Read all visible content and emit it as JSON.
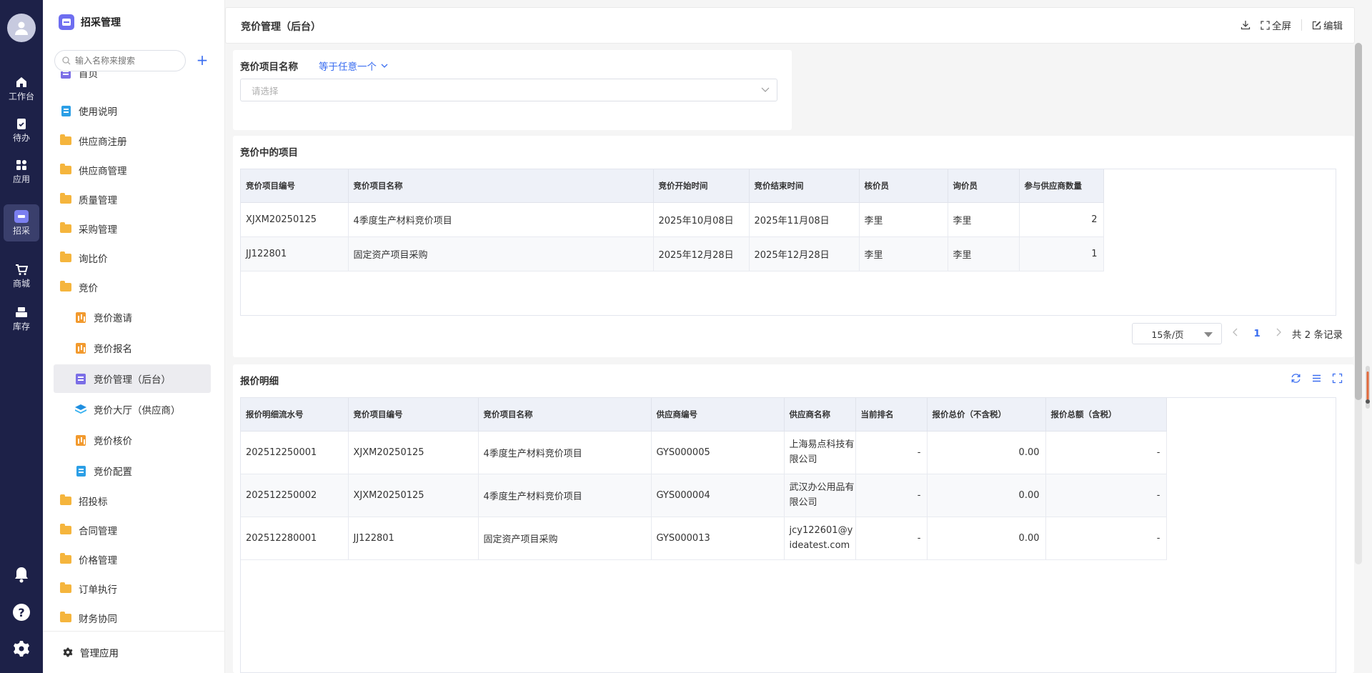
{
  "nav": {
    "items": [
      {
        "label": "工作台",
        "icon": "home-icon"
      },
      {
        "label": "待办",
        "icon": "clipboard-icon"
      },
      {
        "label": "应用",
        "icon": "apps-grid-icon"
      },
      {
        "label": "招采",
        "icon": "procurement-icon"
      },
      {
        "label": "商城",
        "icon": "cart-icon"
      },
      {
        "label": "库存",
        "icon": "inventory-icon"
      }
    ],
    "active_index": 3
  },
  "sidebar": {
    "title": "招采管理",
    "search_placeholder": "输入名称来搜索",
    "add_label": "+",
    "items": [
      {
        "label": "首页",
        "type": "docp",
        "level": 1
      },
      {
        "label": "使用说明",
        "type": "doc",
        "level": 1
      },
      {
        "label": "供应商注册",
        "type": "folder",
        "level": 1
      },
      {
        "label": "供应商管理",
        "type": "folder",
        "level": 1
      },
      {
        "label": "质量管理",
        "type": "folder",
        "level": 1
      },
      {
        "label": "采购管理",
        "type": "folder",
        "level": 1
      },
      {
        "label": "询比价",
        "type": "folder",
        "level": 1
      },
      {
        "label": "竞价",
        "type": "folder",
        "level": 1
      },
      {
        "label": "竞价邀请",
        "type": "chart",
        "level": 2
      },
      {
        "label": "竞价报名",
        "type": "chart",
        "level": 2
      },
      {
        "label": "竞价管理（后台）",
        "type": "docp",
        "level": 2,
        "active": true
      },
      {
        "label": "竞价大厅（供应商）",
        "type": "layers",
        "level": 2
      },
      {
        "label": "竞价核价",
        "type": "chart",
        "level": 2
      },
      {
        "label": "竞价配置",
        "type": "doc",
        "level": 2
      },
      {
        "label": "招投标",
        "type": "folder",
        "level": 1
      },
      {
        "label": "合同管理",
        "type": "folder",
        "level": 1
      },
      {
        "label": "价格管理",
        "type": "folder",
        "level": 1
      },
      {
        "label": "订单执行",
        "type": "folder",
        "level": 1
      },
      {
        "label": "财务协同",
        "type": "folder",
        "level": 1
      }
    ],
    "footer_label": "管理应用"
  },
  "header": {
    "title": "竞价管理（后台）",
    "fullscreen_label": "全屏",
    "edit_label": "编辑"
  },
  "filter": {
    "label": "竞价项目名称",
    "operator": "等于任意一个",
    "placeholder": "请选择"
  },
  "bidding": {
    "title": "竞价中的项目",
    "columns": [
      "竞价项目编号",
      "竞价项目名称",
      "竞价开始时间",
      "竞价结束时间",
      "核价员",
      "询价员",
      "参与供应商数量"
    ],
    "rows": [
      [
        "XJXM20250125",
        "4季度生产材料竞价项目",
        "2025年10月08日",
        "2025年11月08日",
        "李里",
        "李里",
        "2"
      ],
      [
        "JJ122801",
        "固定资产项目采购",
        "2025年12月28日",
        "2025年12月28日",
        "李里",
        "李里",
        "1"
      ]
    ],
    "pager": {
      "page_size": "15条/页",
      "current_page": "1",
      "total_text": "共 2 条记录"
    }
  },
  "quotes": {
    "title": "报价明细",
    "columns": [
      "报价明细流水号",
      "竞价项目编号",
      "竞价项目名称",
      "供应商编号",
      "供应商名称",
      "当前排名",
      "报价总价（不含税）",
      "报价总额（含税）"
    ],
    "rows": [
      [
        "202512250001",
        "XJXM20250125",
        "4季度生产材料竞价项目",
        "GYS000005",
        "上海易点科技有限公司",
        "-",
        "0.00",
        "-"
      ],
      [
        "202512250002",
        "XJXM20250125",
        "4季度生产材料竞价项目",
        "GYS000004",
        "武汉办公用品有限公司",
        "-",
        "0.00",
        "-"
      ],
      [
        "202512280001",
        "JJ122801",
        "固定资产项目采购",
        "GYS000013",
        "jcy122601@yideatest.com",
        "-",
        "0.00",
        "-"
      ]
    ]
  },
  "colors": {
    "nav_bg": "#1d2148",
    "accent": "#3a6df0",
    "folder": "#f5b53d"
  }
}
